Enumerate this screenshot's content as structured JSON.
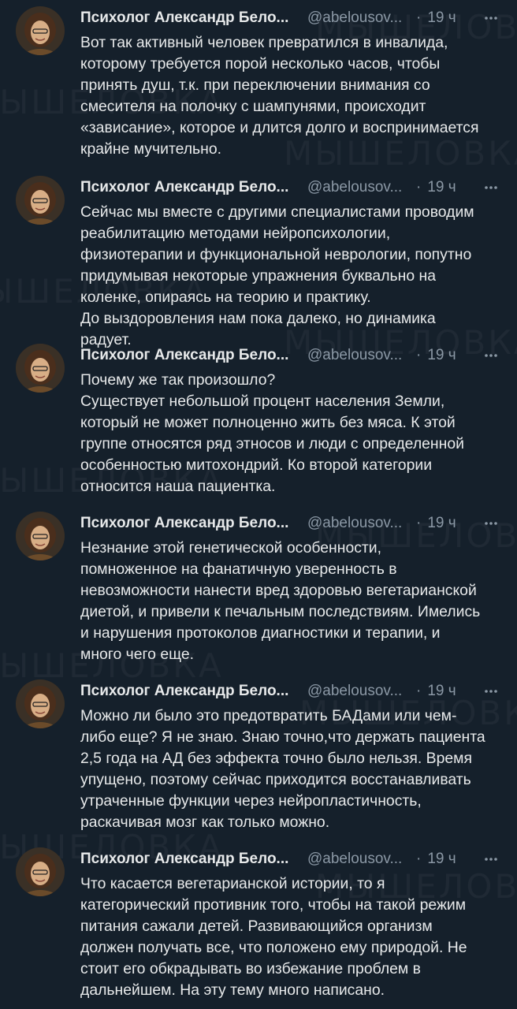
{
  "watermark": "МЫШЕЛОВКА",
  "tweets": [
    {
      "name": "Психолог Александр Бело...",
      "handle": "@abelousov...",
      "dot": "·",
      "time": "19 ч",
      "text": "Вот так активный человек превратился в инвалида,\nкоторому требуется порой несколько часов, чтобы\nпринять душ, т.к. при переключении внимания со\nсмесителя на полочку с шампунями, происходит\n«зависание», которое и длится долго и воспринимается\nкрайне мучительно."
    },
    {
      "name": "Психолог Александр Бело...",
      "handle": "@abelousov...",
      "dot": "·",
      "time": "19 ч",
      "text": "Сейчас мы вместе с другими специалистами проводим\nреабилитацию методами нейропсихологии,\nфизиотерапии и функциональной неврологии, попутно\nпридумывая некоторые упражнения буквально на\nколенке, опираясь на теорию и практику.\nДо выздоровления нам пока далеко, но динамика\nрадует."
    },
    {
      "name": "Психолог Александр Бело...",
      "handle": "@abelousov...",
      "dot": "·",
      "time": "19 ч",
      "text": "Почему же так произошло?\nСуществует небольшой процент населения Земли,\nкоторый не может полноценно жить без мяса. К этой\nгруппе относятся ряд этносов и люди с определенной\nособенностью митохондрий. Ко второй категории\nотносится наша пациентка."
    },
    {
      "name": "Психолог Александр Бело...",
      "handle": "@abelousov...",
      "dot": "·",
      "time": "19 ч",
      "text": "Незнание этой генетической особенности,\nпомноженное на фанатичную уверенность в\nневозможности нанести вред здоровью вегетарианской\nдиетой, и привели к печальным последствиям. Имелись\nи нарушения протоколов диагностики и терапии, и\nмного чего еще."
    },
    {
      "name": "Психолог Александр Бело...",
      "handle": "@abelousov...",
      "dot": "·",
      "time": "19 ч",
      "text": "Можно ли было это предотвратить БАДами или чем-\nлибо еще? Я не знаю. Знаю точно,что держать пациента\n2,5 года на АД без эффекта точно было нельзя. Время\nупущено, поэтому сейчас приходится восстанавливать\nутраченные функции через нейропластичность,\nраскачивая мозг как только можно."
    },
    {
      "name": "Психолог Александр Бело...",
      "handle": "@abelousov...",
      "dot": "·",
      "time": "19 ч",
      "text": "Что касается вегетарианской истории, то я\nкатегорический противник того, чтобы на такой режим\nпитания сажали детей. Развивающийся организм\nдолжен получать все, что положено ему природой. Не\nстоит его обкрадывать во избежание проблем в\nдальнейшем. На эту тему много написано."
    }
  ]
}
